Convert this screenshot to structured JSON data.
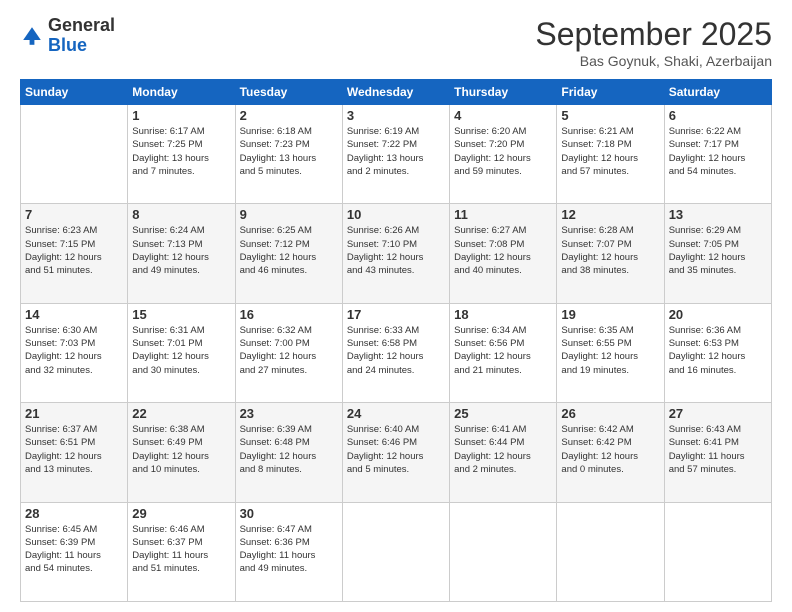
{
  "header": {
    "logo": {
      "general": "General",
      "blue": "Blue"
    },
    "title": "September 2025",
    "location": "Bas Goynuk, Shaki, Azerbaijan"
  },
  "calendar": {
    "days_of_week": [
      "Sunday",
      "Monday",
      "Tuesday",
      "Wednesday",
      "Thursday",
      "Friday",
      "Saturday"
    ],
    "weeks": [
      [
        {
          "day": "",
          "info": ""
        },
        {
          "day": "1",
          "info": "Sunrise: 6:17 AM\nSunset: 7:25 PM\nDaylight: 13 hours\nand 7 minutes."
        },
        {
          "day": "2",
          "info": "Sunrise: 6:18 AM\nSunset: 7:23 PM\nDaylight: 13 hours\nand 5 minutes."
        },
        {
          "day": "3",
          "info": "Sunrise: 6:19 AM\nSunset: 7:22 PM\nDaylight: 13 hours\nand 2 minutes."
        },
        {
          "day": "4",
          "info": "Sunrise: 6:20 AM\nSunset: 7:20 PM\nDaylight: 12 hours\nand 59 minutes."
        },
        {
          "day": "5",
          "info": "Sunrise: 6:21 AM\nSunset: 7:18 PM\nDaylight: 12 hours\nand 57 minutes."
        },
        {
          "day": "6",
          "info": "Sunrise: 6:22 AM\nSunset: 7:17 PM\nDaylight: 12 hours\nand 54 minutes."
        }
      ],
      [
        {
          "day": "7",
          "info": "Sunrise: 6:23 AM\nSunset: 7:15 PM\nDaylight: 12 hours\nand 51 minutes."
        },
        {
          "day": "8",
          "info": "Sunrise: 6:24 AM\nSunset: 7:13 PM\nDaylight: 12 hours\nand 49 minutes."
        },
        {
          "day": "9",
          "info": "Sunrise: 6:25 AM\nSunset: 7:12 PM\nDaylight: 12 hours\nand 46 minutes."
        },
        {
          "day": "10",
          "info": "Sunrise: 6:26 AM\nSunset: 7:10 PM\nDaylight: 12 hours\nand 43 minutes."
        },
        {
          "day": "11",
          "info": "Sunrise: 6:27 AM\nSunset: 7:08 PM\nDaylight: 12 hours\nand 40 minutes."
        },
        {
          "day": "12",
          "info": "Sunrise: 6:28 AM\nSunset: 7:07 PM\nDaylight: 12 hours\nand 38 minutes."
        },
        {
          "day": "13",
          "info": "Sunrise: 6:29 AM\nSunset: 7:05 PM\nDaylight: 12 hours\nand 35 minutes."
        }
      ],
      [
        {
          "day": "14",
          "info": "Sunrise: 6:30 AM\nSunset: 7:03 PM\nDaylight: 12 hours\nand 32 minutes."
        },
        {
          "day": "15",
          "info": "Sunrise: 6:31 AM\nSunset: 7:01 PM\nDaylight: 12 hours\nand 30 minutes."
        },
        {
          "day": "16",
          "info": "Sunrise: 6:32 AM\nSunset: 7:00 PM\nDaylight: 12 hours\nand 27 minutes."
        },
        {
          "day": "17",
          "info": "Sunrise: 6:33 AM\nSunset: 6:58 PM\nDaylight: 12 hours\nand 24 minutes."
        },
        {
          "day": "18",
          "info": "Sunrise: 6:34 AM\nSunset: 6:56 PM\nDaylight: 12 hours\nand 21 minutes."
        },
        {
          "day": "19",
          "info": "Sunrise: 6:35 AM\nSunset: 6:55 PM\nDaylight: 12 hours\nand 19 minutes."
        },
        {
          "day": "20",
          "info": "Sunrise: 6:36 AM\nSunset: 6:53 PM\nDaylight: 12 hours\nand 16 minutes."
        }
      ],
      [
        {
          "day": "21",
          "info": "Sunrise: 6:37 AM\nSunset: 6:51 PM\nDaylight: 12 hours\nand 13 minutes."
        },
        {
          "day": "22",
          "info": "Sunrise: 6:38 AM\nSunset: 6:49 PM\nDaylight: 12 hours\nand 10 minutes."
        },
        {
          "day": "23",
          "info": "Sunrise: 6:39 AM\nSunset: 6:48 PM\nDaylight: 12 hours\nand 8 minutes."
        },
        {
          "day": "24",
          "info": "Sunrise: 6:40 AM\nSunset: 6:46 PM\nDaylight: 12 hours\nand 5 minutes."
        },
        {
          "day": "25",
          "info": "Sunrise: 6:41 AM\nSunset: 6:44 PM\nDaylight: 12 hours\nand 2 minutes."
        },
        {
          "day": "26",
          "info": "Sunrise: 6:42 AM\nSunset: 6:42 PM\nDaylight: 12 hours\nand 0 minutes."
        },
        {
          "day": "27",
          "info": "Sunrise: 6:43 AM\nSunset: 6:41 PM\nDaylight: 11 hours\nand 57 minutes."
        }
      ],
      [
        {
          "day": "28",
          "info": "Sunrise: 6:45 AM\nSunset: 6:39 PM\nDaylight: 11 hours\nand 54 minutes."
        },
        {
          "day": "29",
          "info": "Sunrise: 6:46 AM\nSunset: 6:37 PM\nDaylight: 11 hours\nand 51 minutes."
        },
        {
          "day": "30",
          "info": "Sunrise: 6:47 AM\nSunset: 6:36 PM\nDaylight: 11 hours\nand 49 minutes."
        },
        {
          "day": "",
          "info": ""
        },
        {
          "day": "",
          "info": ""
        },
        {
          "day": "",
          "info": ""
        },
        {
          "day": "",
          "info": ""
        }
      ]
    ]
  }
}
